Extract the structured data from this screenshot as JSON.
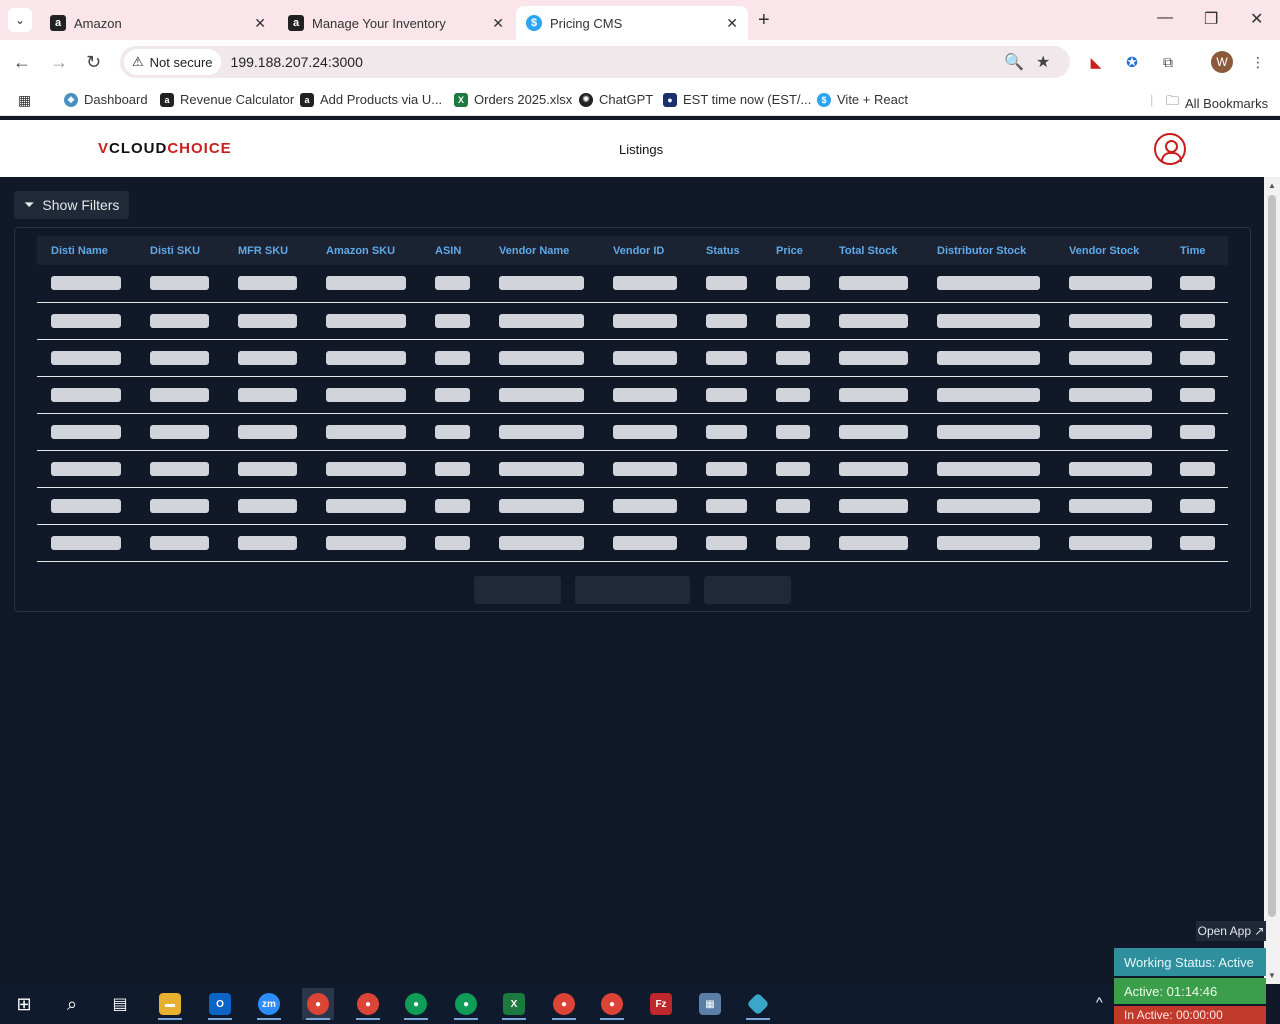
{
  "browser": {
    "tabs": [
      {
        "title": "Amazon",
        "icon": "amazon-icon"
      },
      {
        "title": "Manage Your Inventory",
        "icon": "amazon-icon"
      },
      {
        "title": "Pricing CMS",
        "icon": "dollar-icon"
      }
    ],
    "security_label": "Not secure",
    "url": "199.188.207.24:3000",
    "profile_initial": "W",
    "bookmarks": [
      {
        "label": "Dashboard",
        "icon": "dashboard-icon"
      },
      {
        "label": "Revenue Calculator",
        "icon": "amazon-icon"
      },
      {
        "label": "Add Products via U...",
        "icon": "amazon-icon"
      },
      {
        "label": "Orders 2025.xlsx",
        "icon": "excel-icon"
      },
      {
        "label": "ChatGPT",
        "icon": "chatgpt-icon"
      },
      {
        "label": "EST time now (EST/...",
        "icon": "globe-icon"
      },
      {
        "label": "Vite + React",
        "icon": "dollar-icon"
      }
    ],
    "all_bookmarks": "All Bookmarks"
  },
  "app": {
    "logo": {
      "v": "V",
      "cloud": "CLOUD",
      "choice": "CHOICE"
    },
    "title": "Listings",
    "show_filters": "Show Filters",
    "columns": [
      "Disti Name",
      "Disti SKU",
      "MFR SKU",
      "Amazon SKU",
      "ASIN",
      "Vendor Name",
      "Vendor ID",
      "Status",
      "Price",
      "Total Stock",
      "Distributor Stock",
      "Vendor Stock",
      "Time"
    ],
    "accent": "#5ea9e8",
    "brand": "#c81e1e"
  },
  "tracker": {
    "open_app": "Open App ↗",
    "working_status": "Working Status: Active",
    "active": "Active: 01:14:46",
    "inactive": "In Active: 00:00:00"
  }
}
